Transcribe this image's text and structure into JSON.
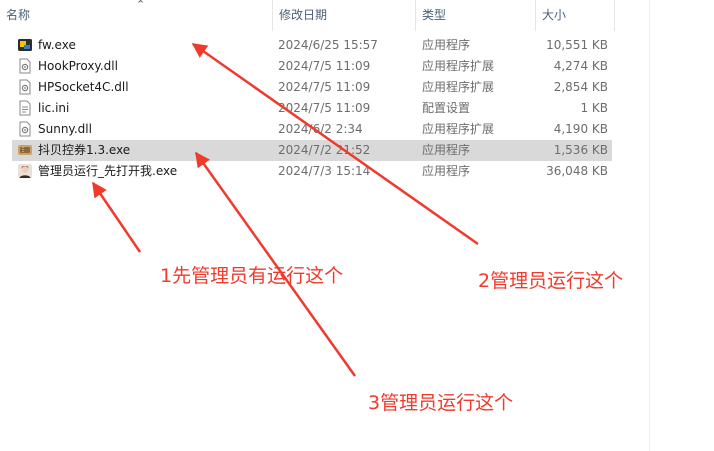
{
  "columns": {
    "name": "名称",
    "date": "修改日期",
    "type": "类型",
    "size": "大小"
  },
  "files": [
    {
      "name": "fw.exe",
      "date": "2024/6/25 15:57",
      "type": "应用程序",
      "size": "10,551 KB",
      "icon": "app-exe-icon"
    },
    {
      "name": "HookProxy.dll",
      "date": "2024/7/5 11:09",
      "type": "应用程序扩展",
      "size": "4,274 KB",
      "icon": "dll-file-icon"
    },
    {
      "name": "HPSocket4C.dll",
      "date": "2024/7/5 11:09",
      "type": "应用程序扩展",
      "size": "2,854 KB",
      "icon": "dll-file-icon"
    },
    {
      "name": "lic.ini",
      "date": "2024/7/5 11:09",
      "type": "配置设置",
      "size": "1 KB",
      "icon": "ini-file-icon"
    },
    {
      "name": "Sunny.dll",
      "date": "2024/6/2 2:34",
      "type": "应用程序扩展",
      "size": "4,190 KB",
      "icon": "dll-file-icon"
    },
    {
      "name": "抖贝控券1.3.exe",
      "date": "2024/7/2 21:52",
      "type": "应用程序",
      "size": "1,536 KB",
      "icon": "coupon-app-icon"
    },
    {
      "name": "管理员运行_先打开我.exe",
      "date": "2024/7/3 15:14",
      "type": "应用程序",
      "size": "36,048 KB",
      "icon": "avatar-app-icon"
    }
  ],
  "annotations": {
    "step1": "1先管理员有运行这个",
    "step2": "2管理员运行这个",
    "step3": "3管理员运行这个"
  },
  "colors": {
    "annotation": "#f03a2c",
    "selected_row": "#d9d9d9",
    "header_text": "#4c607a"
  }
}
